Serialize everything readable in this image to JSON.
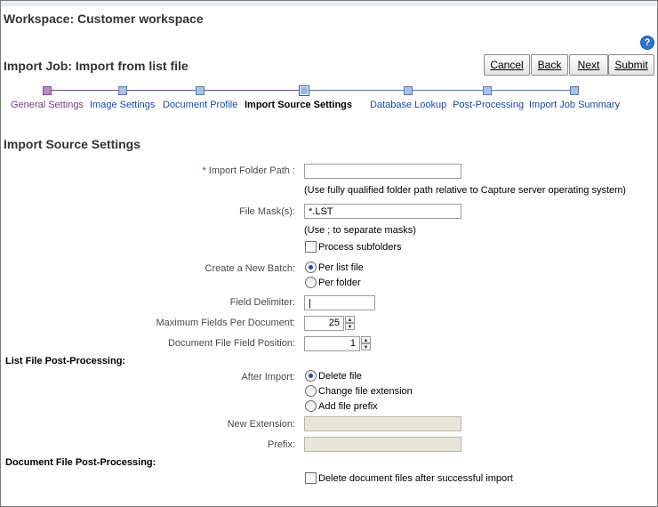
{
  "workspace": {
    "title": "Workspace: Customer workspace"
  },
  "help": {
    "icon": "help-icon",
    "glyph": "?"
  },
  "job": {
    "title": "Import Job: Import from list file"
  },
  "buttons": {
    "cancel": "Cancel",
    "back": "Back",
    "next": "Next",
    "submit": "Submit"
  },
  "train": {
    "steps": [
      {
        "label": "General Settings",
        "state": "visited"
      },
      {
        "label": "Image Settings",
        "state": "unvisited"
      },
      {
        "label": "Document Profile",
        "state": "unvisited"
      },
      {
        "label": "Import Source Settings",
        "state": "current"
      },
      {
        "label": "Database Lookup",
        "state": "unvisited"
      },
      {
        "label": "Post-Processing",
        "state": "unvisited"
      },
      {
        "label": "Import Job Summary",
        "state": "unvisited"
      }
    ]
  },
  "section": {
    "title": "Import Source Settings"
  },
  "form": {
    "import_folder_path": {
      "required_mark": "*",
      "label": "Import Folder Path :",
      "value": "",
      "help": "(Use fully qualified folder path relative to Capture server operating system)"
    },
    "file_mask": {
      "label": "File Mask(s):",
      "value": "*.LST",
      "help": "(Use ; to separate masks)"
    },
    "process_subfolders": {
      "label": "Process subfolders",
      "checked": false
    },
    "create_batch": {
      "label": "Create a New Batch:",
      "options": [
        "Per list file",
        "Per folder"
      ],
      "selected": "Per list file"
    },
    "field_delimiter": {
      "label": "Field Delimiter:",
      "value": "|"
    },
    "max_fields": {
      "label": "Maximum Fields Per Document:",
      "value": "25"
    },
    "doc_field_position": {
      "label": "Document File Field Position:",
      "value": "1"
    },
    "list_post_heading": "List File Post-Processing:",
    "after_import": {
      "label": "After Import:",
      "options": [
        "Delete file",
        "Change file extension",
        "Add file prefix"
      ],
      "selected": "Delete file"
    },
    "new_extension": {
      "label": "New Extension:",
      "value": ""
    },
    "prefix": {
      "label": "Prefix:",
      "value": ""
    },
    "doc_post_heading": "Document File Post-Processing:",
    "delete_docs": {
      "label": "Delete document files after successful import",
      "checked": false
    }
  }
}
